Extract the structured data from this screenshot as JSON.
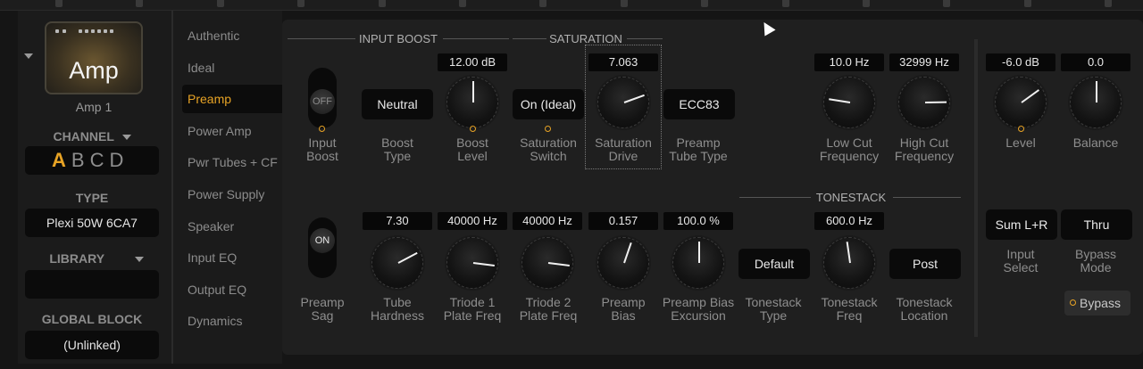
{
  "left": {
    "amp_tile_label": "Amp",
    "amp_name": "Amp 1",
    "channel_heading": "CHANNEL",
    "channels": [
      "A",
      "B",
      "C",
      "D"
    ],
    "active_channel": "A",
    "type_heading": "TYPE",
    "type_value": "Plexi 50W 6CA7",
    "library_heading": "LIBRARY",
    "library_value": "",
    "global_block_heading": "GLOBAL BLOCK",
    "global_block_value": "(Unlinked)"
  },
  "nav": {
    "items": [
      "Authentic",
      "Ideal",
      "Preamp",
      "Power Amp",
      "Pwr Tubes + CF",
      "Power Supply",
      "Speaker",
      "Input EQ",
      "Output EQ",
      "Dynamics"
    ],
    "active": "Preamp"
  },
  "groups": {
    "input_boost": "INPUT BOOST",
    "saturation": "SATURATION",
    "tonestack": "TONESTACK"
  },
  "row1": {
    "input_boost": {
      "toggle": "OFF",
      "label1": "Input",
      "label2": "Boost"
    },
    "boost_type": {
      "button": "Neutral",
      "label1": "Boost",
      "label2": "Type"
    },
    "boost_level": {
      "value": "12.00 dB",
      "label1": "Boost",
      "label2": "Level",
      "fraction": 0.5
    },
    "saturation_switch": {
      "button": "On (Ideal)",
      "label1": "Saturation",
      "label2": "Switch"
    },
    "saturation_drive": {
      "value": "7.063",
      "label1": "Saturation",
      "label2": "Drive",
      "fraction": 0.76
    },
    "preamp_tube_type": {
      "button": "ECC83",
      "label1": "Preamp",
      "label2": "Tube Type"
    },
    "low_cut": {
      "value": "10.0 Hz",
      "label1": "Low Cut",
      "label2": "Frequency",
      "fraction": 0.2
    },
    "high_cut": {
      "value": "32999 Hz",
      "label1": "High Cut",
      "label2": "Frequency",
      "fraction": 0.83
    },
    "level": {
      "value": "-6.0 dB",
      "label1": "Level",
      "label2": "",
      "fraction": 0.7
    },
    "balance": {
      "value": "0.0",
      "label1": "Balance",
      "label2": "",
      "fraction": 0.5
    }
  },
  "row2": {
    "preamp_sag": {
      "toggle": "ON",
      "label1": "Preamp",
      "label2": "Sag"
    },
    "tube_hardness": {
      "value": "7.30",
      "label1": "Tube",
      "label2": "Hardness",
      "fraction": 0.73
    },
    "triode1": {
      "value": "40000 Hz",
      "label1": "Triode 1",
      "label2": "Plate Freq",
      "fraction": 0.86
    },
    "triode2": {
      "value": "40000 Hz",
      "label1": "Triode 2",
      "label2": "Plate Freq",
      "fraction": 0.86
    },
    "preamp_bias": {
      "value": "0.157",
      "label1": "Preamp",
      "label2": "Bias",
      "fraction": 0.57
    },
    "preamp_bias_excursion": {
      "value": "100.0 %",
      "label1": "Preamp Bias",
      "label2": "Excursion",
      "fraction": 0.5
    },
    "tonestack_type": {
      "button": "Default",
      "label1": "Tonestack",
      "label2": "Type"
    },
    "tonestack_freq": {
      "value": "600.0 Hz",
      "label1": "Tonestack",
      "label2": "Freq",
      "fraction": 0.47
    },
    "tonestack_location": {
      "button": "Post",
      "label1": "Tonestack",
      "label2": "Location"
    },
    "input_select": {
      "button": "Sum L+R",
      "label1": "Input",
      "label2": "Select"
    },
    "bypass_mode": {
      "button": "Thru",
      "label1": "Bypass",
      "label2": "Mode"
    }
  },
  "bypass_label": "Bypass",
  "colors": {
    "accent": "#e7a325",
    "panel": "#1f1f1f",
    "background": "#151515"
  }
}
